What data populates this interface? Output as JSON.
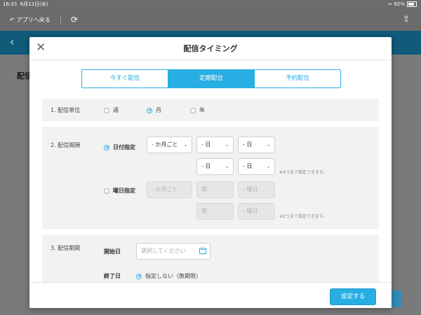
{
  "status_bar": {
    "time": "16:33",
    "date": "6月12日(水)",
    "battery": "82%"
  },
  "toolbar": {
    "back_label": "アプリへ戻る"
  },
  "background": {
    "title": "配信"
  },
  "modal": {
    "title": "配信タイミング",
    "tabs": [
      {
        "label": "今すぐ配信",
        "active": false
      },
      {
        "label": "定期配信",
        "active": true
      },
      {
        "label": "予約配信",
        "active": false
      }
    ],
    "unit": {
      "label": "1. 配信単位",
      "options": [
        {
          "label": "週",
          "selected": false
        },
        {
          "label": "月",
          "selected": true
        },
        {
          "label": "年",
          "selected": false
        }
      ]
    },
    "interval": {
      "label": "2. 配信間隔",
      "date_spec": {
        "label": "日付指定",
        "selected": true,
        "row1": [
          "- か月ごと",
          "- 日",
          "- 日"
        ],
        "row2": [
          "- 日",
          "- 日"
        ],
        "note": "※4つまで指定できます。"
      },
      "weekday_spec": {
        "label": "曜日指定",
        "selected": false,
        "row1": [
          "- か月ごと",
          "第-",
          "- 曜日"
        ],
        "row2": [
          "第-",
          "- 曜日"
        ],
        "note": "※2つまで指定できます。"
      }
    },
    "period": {
      "label": "3. 配信期間",
      "start_label": "開始日",
      "start_placeholder": "選択してください",
      "end_label": "終了日",
      "end_option": "指定しない（無期限）"
    },
    "submit_label": "設定する"
  },
  "colors": {
    "accent": "#27aee3",
    "header_bg": "#105a7a"
  }
}
